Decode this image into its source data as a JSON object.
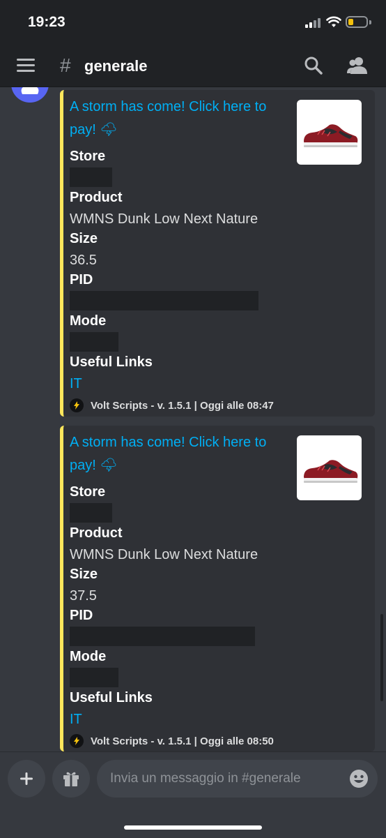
{
  "status_bar": {
    "time": "19:23"
  },
  "header": {
    "hash": "#",
    "channel": "generale"
  },
  "messages": [
    {
      "title": "A storm has come! Click here to pay! 🌩",
      "fields": {
        "store_label": "Store",
        "product_label": "Product",
        "product_value": "WMNS Dunk Low Next Nature",
        "size_label": "Size",
        "size_value": "36.5",
        "pid_label": "PID",
        "mode_label": "Mode",
        "links_label": "Useful Links",
        "links_value": "IT"
      },
      "footer": "Volt Scripts - v. 1.5.1 | Oggi alle 08:47"
    },
    {
      "title": "A storm has come! Click here to pay! 🌩",
      "fields": {
        "store_label": "Store",
        "product_label": "Product",
        "product_value": "WMNS Dunk Low Next Nature",
        "size_label": "Size",
        "size_value": "37.5",
        "pid_label": "PID",
        "mode_label": "Mode",
        "links_label": "Useful Links",
        "links_value": "IT"
      },
      "footer": "Volt Scripts - v. 1.5.1 | Oggi alle 08:50"
    }
  ],
  "composer": {
    "placeholder": "Invia un messaggio in #generale"
  },
  "colors": {
    "accent_link": "#00aff4",
    "embed_bar": "#fee75c",
    "background": "#36393f"
  },
  "icons": [
    "menu-icon",
    "search-icon",
    "members-icon",
    "plus-icon",
    "gift-icon",
    "emoji-icon",
    "lightning-icon",
    "sneaker-thumbnail"
  ]
}
